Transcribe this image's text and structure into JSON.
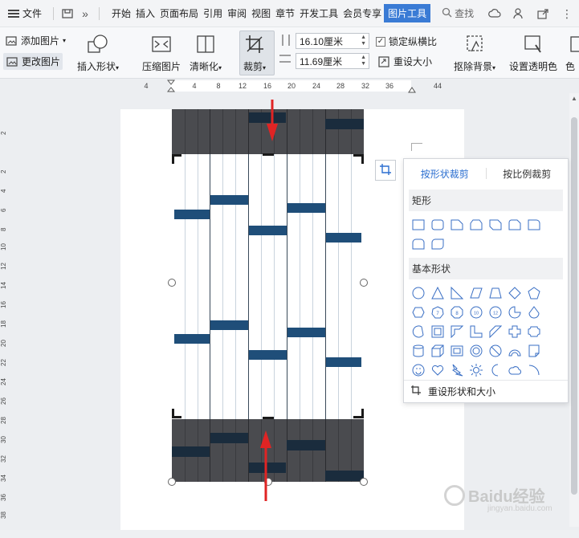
{
  "menubar": {
    "file_label": "文件",
    "tabs": [
      "开始",
      "插入",
      "页面布局",
      "引用",
      "审阅",
      "视图",
      "章节",
      "开发工具",
      "会员专享",
      "图片工具"
    ],
    "active_tab": "图片工具",
    "search_label": "查找"
  },
  "ribbon": {
    "add_picture": "添加图片",
    "change_picture": "更改图片",
    "insert_shape": "插入形状",
    "compress": "压缩图片",
    "clarify": "清晰化",
    "crop": "裁剪",
    "width_value": "16.10厘米",
    "height_value": "11.69厘米",
    "lock_ratio": "锁定纵横比",
    "lock_ratio_checked": true,
    "reset_size": "重设大小",
    "remove_bg": "抠除背景",
    "set_transparent": "设置透明色",
    "color_partial": "色"
  },
  "ruler": {
    "h_ticks": [
      "4",
      "4",
      "8",
      "12",
      "16",
      "20",
      "24",
      "28",
      "32",
      "36",
      "44"
    ],
    "v_ticks": [
      "2",
      "2",
      "4",
      "6",
      "8",
      "10",
      "12",
      "14",
      "16",
      "18",
      "20",
      "22",
      "24",
      "26",
      "28",
      "30",
      "32",
      "34",
      "36",
      "38",
      "40"
    ]
  },
  "crop_popup": {
    "tab_shape": "按形状裁剪",
    "tab_ratio": "按比例裁剪",
    "section_rect": "矩形",
    "section_basic": "基本形状",
    "reset_label": "重设形状和大小",
    "rect_shapes": [
      "rect-icon",
      "rounded-rect-icon",
      "snip-corner-rect-icon",
      "snip-same-side-rect-icon",
      "snip-diagonal-rect-icon",
      "snip-round-rect-icon",
      "round-single-corner-rect-icon",
      "round-same-side-rect-icon",
      "round-diagonal-rect-icon"
    ],
    "basic_shapes": [
      "oval-icon",
      "triangle-icon",
      "right-triangle-icon",
      "parallelogram-icon",
      "trapezoid-icon",
      "diamond-icon",
      "pentagon-icon",
      "hexagon-icon",
      "heptagon-icon",
      "octagon-icon",
      "decagon-icon",
      "dodecagon-icon",
      "pie-icon",
      "teardrop-icon",
      "chord-icon",
      "frame-icon",
      "half-frame-icon",
      "l-shape-icon",
      "diagonal-stripe-icon",
      "plus-icon",
      "plaque-icon",
      "can-icon",
      "cube-icon",
      "bevel-icon",
      "donut-icon",
      "no-symbol-icon",
      "block-arc-icon",
      "folded-corner-icon",
      "smiley-icon",
      "heart-icon",
      "lightning-icon",
      "sun-icon",
      "moon-icon",
      "cloud-icon",
      "arc-icon"
    ],
    "shape_labels": {
      "heptagon": "7",
      "octagon": "8",
      "decagon": "10",
      "dodecagon": "12"
    }
  },
  "watermark": {
    "brand": "Baidu经验",
    "sub": "jingyan.baidu.com"
  },
  "colors": {
    "accent": "#3a7bd5",
    "band": "#1f4e79",
    "dark": "#4a4b4f",
    "arrow": "#e02424"
  }
}
